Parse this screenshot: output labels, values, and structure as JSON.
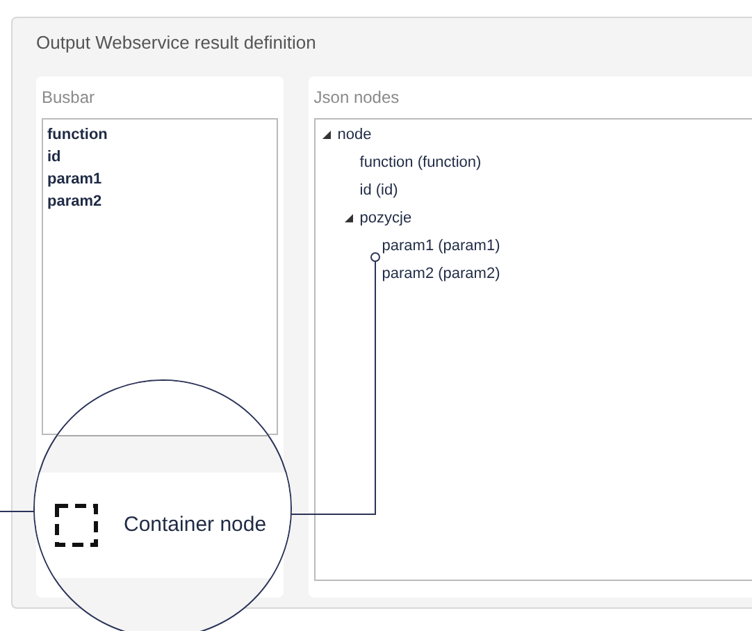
{
  "window": {
    "title": "Output Webservice result definition"
  },
  "busbar": {
    "title": "Busbar",
    "items": [
      "function",
      "id",
      "param1",
      "param2"
    ]
  },
  "json_nodes": {
    "title": "Json nodes",
    "tree": [
      {
        "label": "node",
        "expanded": true,
        "children": [
          {
            "label": "function (function)"
          },
          {
            "label": "id (id)"
          },
          {
            "label": "pozycje",
            "expanded": true,
            "children": [
              {
                "label": "param1 (param1)"
              },
              {
                "label": "param2 (param2)"
              }
            ]
          }
        ]
      }
    ]
  },
  "callout": {
    "label": "Container node"
  }
}
